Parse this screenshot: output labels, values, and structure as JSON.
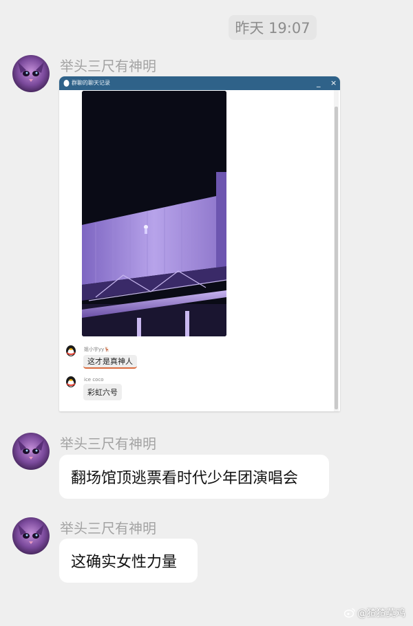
{
  "header": {
    "timestamp": "昨天 19:07"
  },
  "messages": [
    {
      "sender": "举头三尺有神明"
    },
    {
      "sender": "举头三尺有神明",
      "text": "翻场馆顶逃票看时代少年团演唱会"
    },
    {
      "sender": "举头三尺有神明",
      "text": "这确实女性力量"
    }
  ],
  "screenshot": {
    "window_title": "群聊的聊天记录",
    "minimize_label": "_",
    "close_label": "×",
    "chat": [
      {
        "name": "姐小宇yy🦌",
        "text": "这才是真神人"
      },
      {
        "name": "ice coco",
        "text": "彩虹六号"
      }
    ]
  },
  "watermark": "@猹猹莫鸡",
  "colors": {
    "titlebar": "#2f6289",
    "bubble": "#ffffff",
    "background": "#efefef"
  }
}
